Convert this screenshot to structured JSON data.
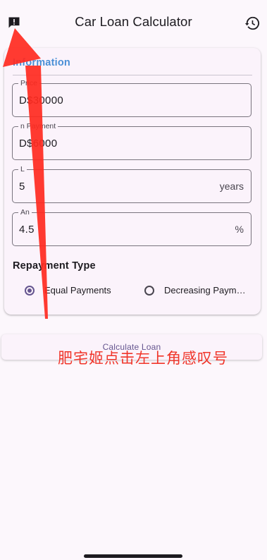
{
  "app_bar": {
    "title": "Car Loan Calculator",
    "left_icon": "feedback-icon",
    "right_icon": "history-icon"
  },
  "loan_info": {
    "section_title": "Information",
    "fields": [
      {
        "label": "Price",
        "value": "D$30000",
        "suffix": ""
      },
      {
        "label": "n Payment",
        "value": "D$6000",
        "suffix": ""
      },
      {
        "label": "L",
        "value": "5",
        "suffix": "years"
      },
      {
        "label": "An",
        "value": "4.5",
        "suffix": "%"
      }
    ]
  },
  "repayment": {
    "title": "Repayment Type",
    "options": [
      {
        "label": "Equal Payments",
        "selected": true
      },
      {
        "label": "Decreasing Paym…",
        "selected": false
      }
    ]
  },
  "calculate_button": {
    "label": "Calculate Loan"
  },
  "annotation": {
    "text": "肥宅姬点击左上角感叹号",
    "color": "#f0352a"
  },
  "colors": {
    "accent": "#65558f",
    "section_title": "#4a8fd6",
    "annotation": "#f0352a"
  }
}
